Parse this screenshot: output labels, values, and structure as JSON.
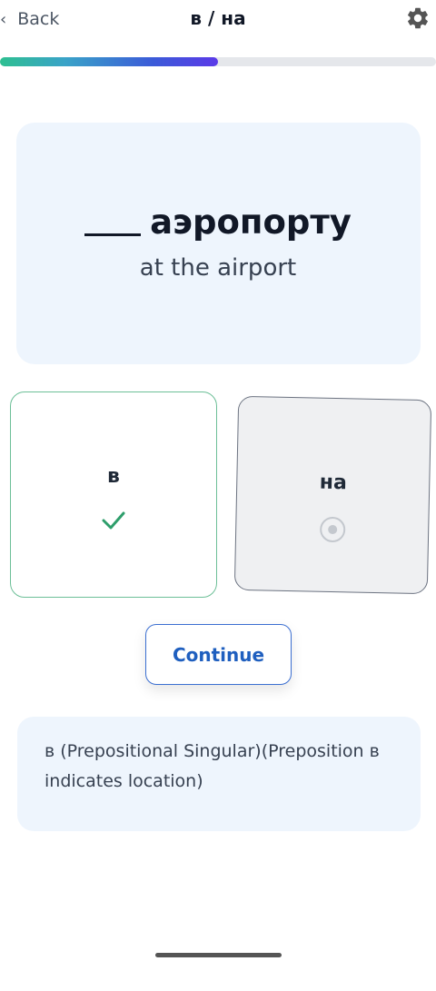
{
  "header": {
    "back_label": "Back",
    "title": "в / на",
    "back_icon": "chevron-left-icon",
    "settings_icon": "gear-icon"
  },
  "progress": {
    "fraction": 0.5
  },
  "prompt": {
    "word": "аэропорту",
    "translation": "at the airport"
  },
  "options": [
    {
      "label": "в",
      "state": "correct",
      "icon": "checkmark-icon"
    },
    {
      "label": "на",
      "state": "unselected",
      "icon": "radio-icon"
    }
  ],
  "continue_label": "Continue",
  "explanation": "в (Prepositional Singular)(Preposition в indicates location)",
  "colors": {
    "accent": "#1f5fbf",
    "correct": "#2e9e6b",
    "card_bg": "#eef5fd"
  }
}
